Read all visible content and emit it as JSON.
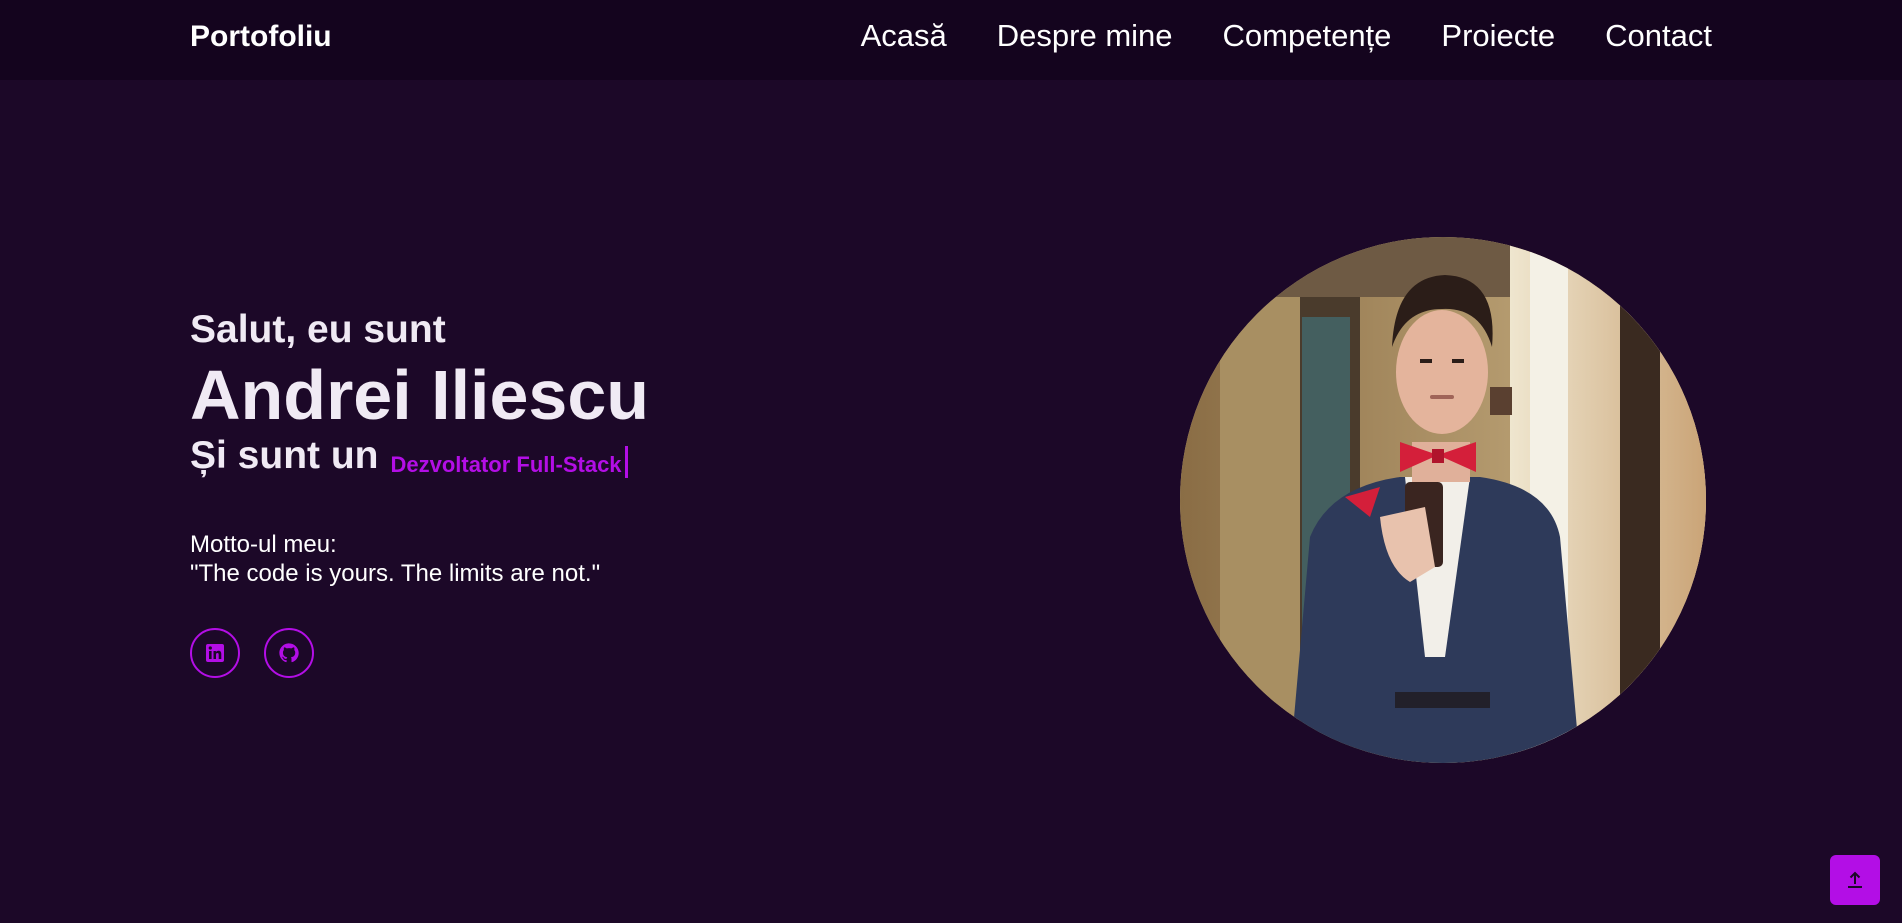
{
  "navbar": {
    "brand": "Portofoliu",
    "links": [
      {
        "label": "Acasă"
      },
      {
        "label": "Despre mine"
      },
      {
        "label": "Competențe"
      },
      {
        "label": "Proiecte"
      },
      {
        "label": "Contact"
      }
    ]
  },
  "hero": {
    "greeting": "Salut, eu sunt",
    "name": "Andrei Iliescu",
    "role_prefix": "Și sunt un",
    "role": "Dezvoltator Full-Stack",
    "motto_label": "Motto-ul meu:",
    "motto": "\"The code is yours. The limits are not.\"",
    "social": [
      {
        "icon": "linkedin-icon"
      },
      {
        "icon": "github-icon"
      }
    ]
  },
  "colors": {
    "background": "#1c0828",
    "navbar": "#14041e",
    "accent": "#b30ee6",
    "text": "#ffffff"
  },
  "icons": {
    "scroll_top": "arrow-up-icon"
  }
}
